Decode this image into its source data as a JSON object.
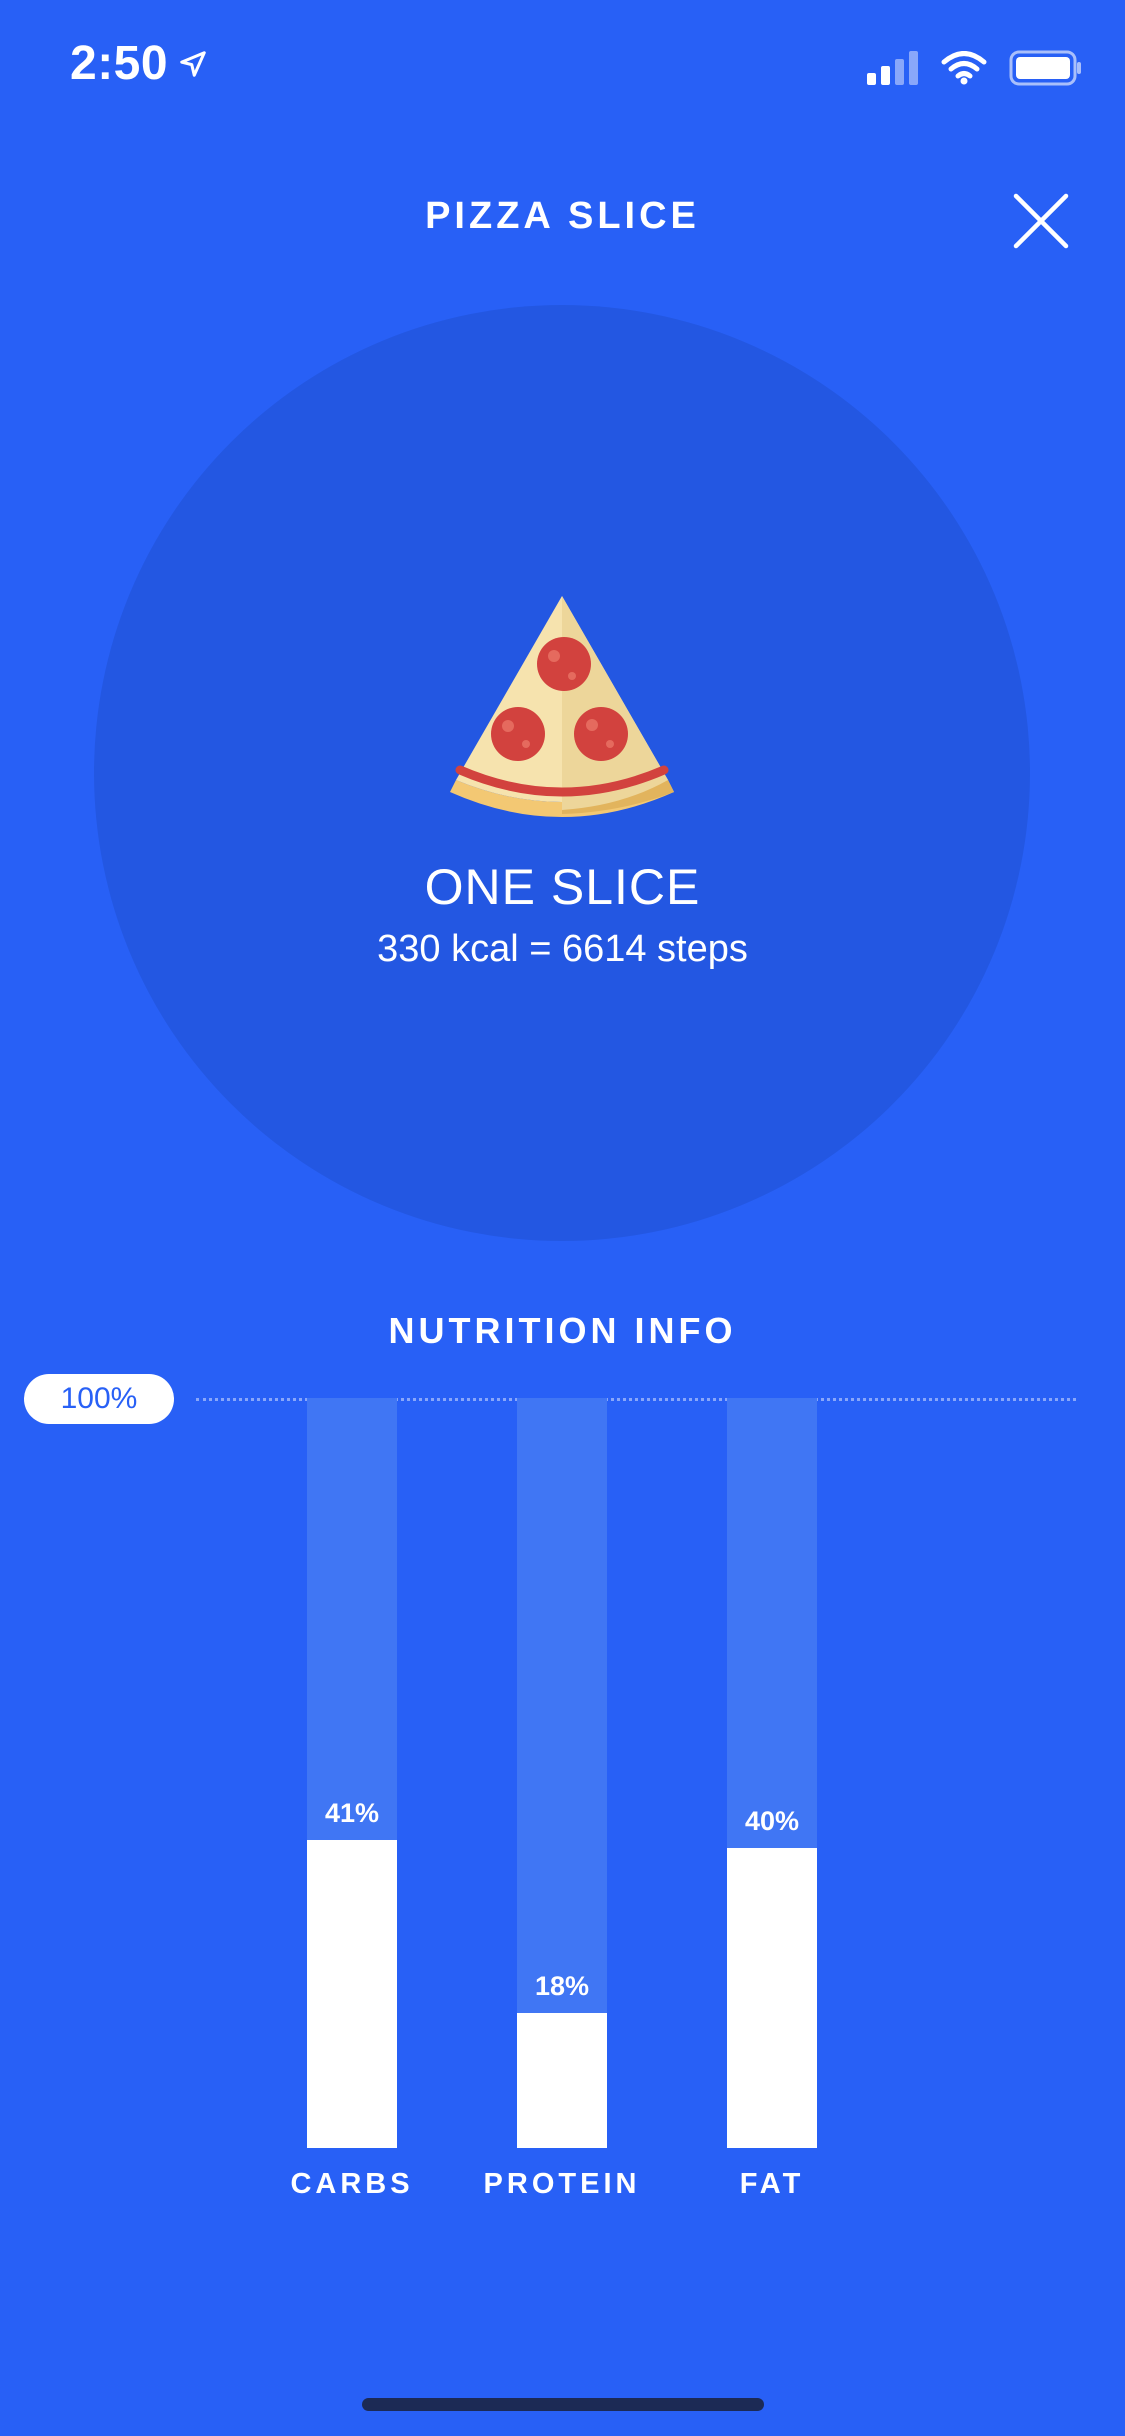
{
  "status_bar": {
    "time": "2:50",
    "icons": [
      "location-arrow-icon",
      "cellular-signal-icon",
      "wifi-icon",
      "battery-icon"
    ]
  },
  "header": {
    "title": "PIZZA SLICE",
    "close_icon": "close-icon"
  },
  "hero": {
    "image_icon": "pizza-slice-icon",
    "serving": "ONE SLICE",
    "calories": "330 kcal = 6614 steps"
  },
  "nutrition": {
    "title": "NUTRITION INFO",
    "max_label": "100%",
    "chart_data": {
      "type": "bar",
      "categories": [
        "CARBS",
        "PROTEIN",
        "FAT"
      ],
      "values": [
        41,
        18,
        40
      ],
      "value_labels": [
        "41%",
        "18%",
        "40%"
      ],
      "ylim": [
        0,
        100
      ]
    }
  },
  "colors": {
    "background": "#2860F6",
    "hero_circle": "#2357E2",
    "bar_track": "#4076F4",
    "bar_fill": "#ffffff"
  }
}
